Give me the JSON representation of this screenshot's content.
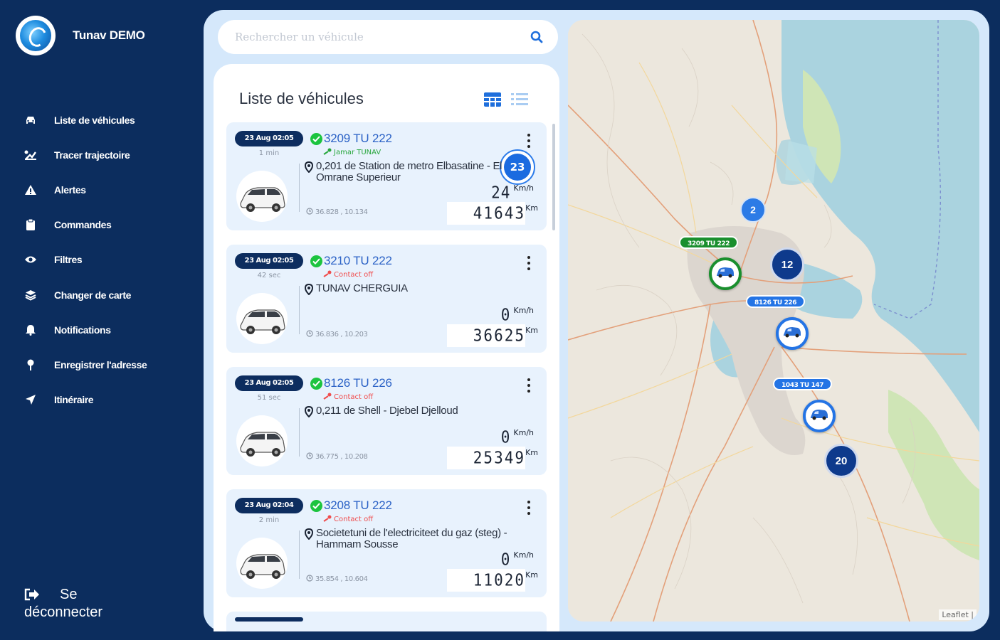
{
  "app": {
    "name": "Tunav DEMO"
  },
  "sidebar": {
    "items": [
      {
        "label": "Liste de véhicules",
        "icon": "car-icon"
      },
      {
        "label": "Tracer trajectoire",
        "icon": "route-icon"
      },
      {
        "label": "Alertes",
        "icon": "alert-icon"
      },
      {
        "label": "Commandes",
        "icon": "clipboard-icon"
      },
      {
        "label": "Filtres",
        "icon": "eye-icon"
      },
      {
        "label": "Changer de carte",
        "icon": "layers-icon"
      },
      {
        "label": "Notifications",
        "icon": "bell-icon"
      },
      {
        "label": "Enregistrer l'adresse",
        "icon": "map-pin-icon"
      },
      {
        "label": "Itinéraire",
        "icon": "navigation-icon"
      }
    ],
    "logout_line1": "Se",
    "logout_line2": "déconnecter"
  },
  "search": {
    "placeholder": "Rechercher un véhicule"
  },
  "list": {
    "title": "Liste de véhicules",
    "vehicles": [
      {
        "date": "23 Aug 02:05",
        "ago": "1 min",
        "plate": "3209 TU 222",
        "contact": "Jamar TUNAV",
        "contact_on": true,
        "address": "0,201 de Station de metro Elbasatine - El Omrane Superieur",
        "coords": "36.828 , 10.134",
        "speed": "24",
        "speed_unit": "Km/h",
        "odometer": "41643",
        "odometer_unit": "Km",
        "badge": "23"
      },
      {
        "date": "23 Aug 02:05",
        "ago": "42 sec",
        "plate": "3210 TU 222",
        "contact": "Contact off",
        "contact_on": false,
        "address": "TUNAV CHERGUIA",
        "coords": "36.836 , 10.203",
        "speed": "0",
        "speed_unit": "Km/h",
        "odometer": "36625",
        "odometer_unit": "Km"
      },
      {
        "date": "23 Aug 02:05",
        "ago": "51 sec",
        "plate": "8126 TU 226",
        "contact": "Contact off",
        "contact_on": false,
        "address": "0,211 de Shell - Djebel Djelloud",
        "coords": "36.775 , 10.208",
        "speed": "0",
        "speed_unit": "Km/h",
        "odometer": "25349",
        "odometer_unit": "Km"
      },
      {
        "date": "23 Aug 02:04",
        "ago": "2 min",
        "plate": "3208 TU 222",
        "contact": "Contact off",
        "contact_on": false,
        "address": "Societetuni de l'electriciteet du gaz (steg) - Hammam Sousse",
        "coords": "35.854 , 10.604",
        "speed": "0",
        "speed_unit": "Km/h",
        "odometer": "11020",
        "odometer_unit": "Km"
      }
    ]
  },
  "map": {
    "clusters": [
      {
        "count": "2"
      },
      {
        "count": "12"
      },
      {
        "count": "20"
      }
    ],
    "markers": [
      {
        "label": "3209 TU 222"
      },
      {
        "label": "8126 TU 226"
      },
      {
        "label": "1043 TU 147"
      }
    ],
    "attribution": "Leaflet |"
  },
  "colors": {
    "sidebar_bg": "#0c2d5e",
    "panel_bg": "#d5e8fb",
    "accent": "#2474e5",
    "contact_on": "#27a63c",
    "contact_off": "#f04c4c"
  }
}
